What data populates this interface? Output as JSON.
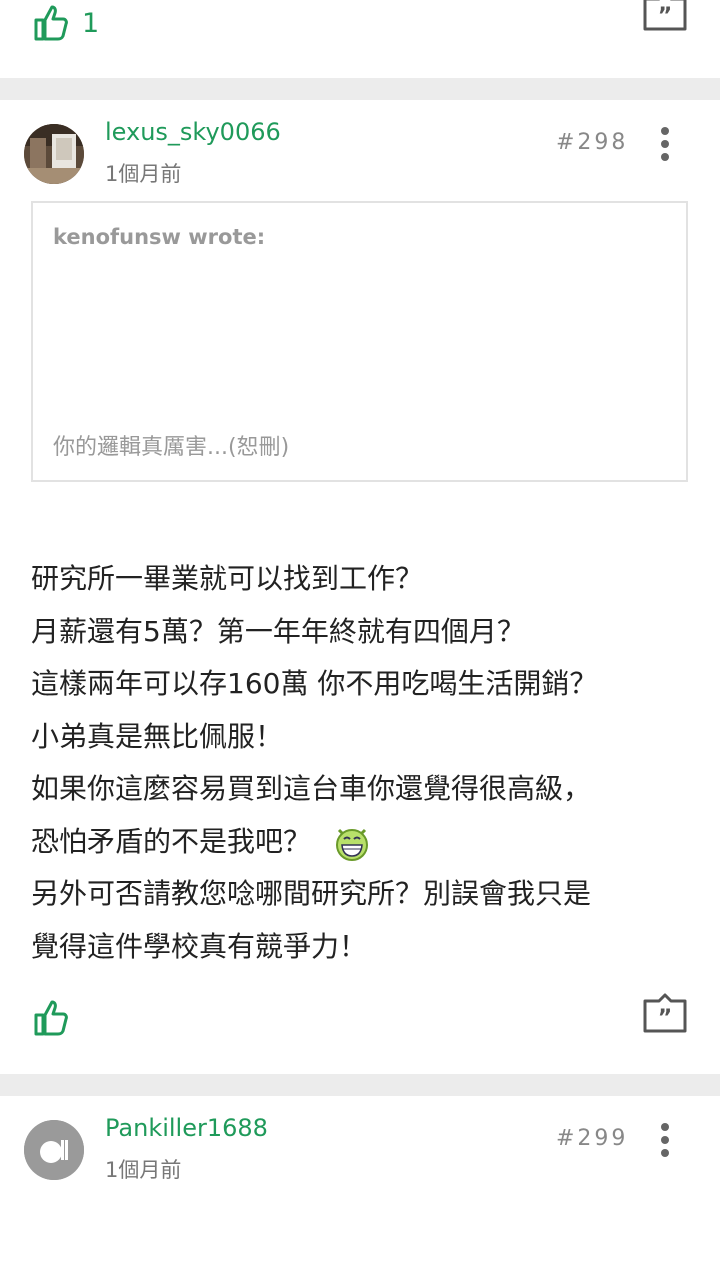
{
  "prev_post": {
    "like_count": "1"
  },
  "post_298": {
    "username": "lexus_sky0066",
    "time": "1個月前",
    "floor": "#298",
    "quote": {
      "author": "kenofunsw wrote:",
      "text": "你的邏輯真厲害...(恕刪)"
    },
    "lines": [
      "研究所一畢業就可以找到工作？",
      "月薪還有5萬？第一年年終就有四個月？",
      "這樣兩年可以存160萬 你不用吃喝生活開銷？",
      "小弟真是無比佩服！",
      "如果你這麼容易買到這台車你還覺得很高級，",
      "恐怕矛盾的不是我吧？",
      "另外可否請教您唸哪間研究所？別誤會我只是",
      "覺得這件學校真有競爭力！"
    ],
    "emoji": "grin-emoji"
  },
  "post_299": {
    "username": "Pankiller1688",
    "time": "1個月前",
    "floor": "#299"
  },
  "colors": {
    "accent": "#1f9a5a",
    "separator": "#ececec"
  }
}
